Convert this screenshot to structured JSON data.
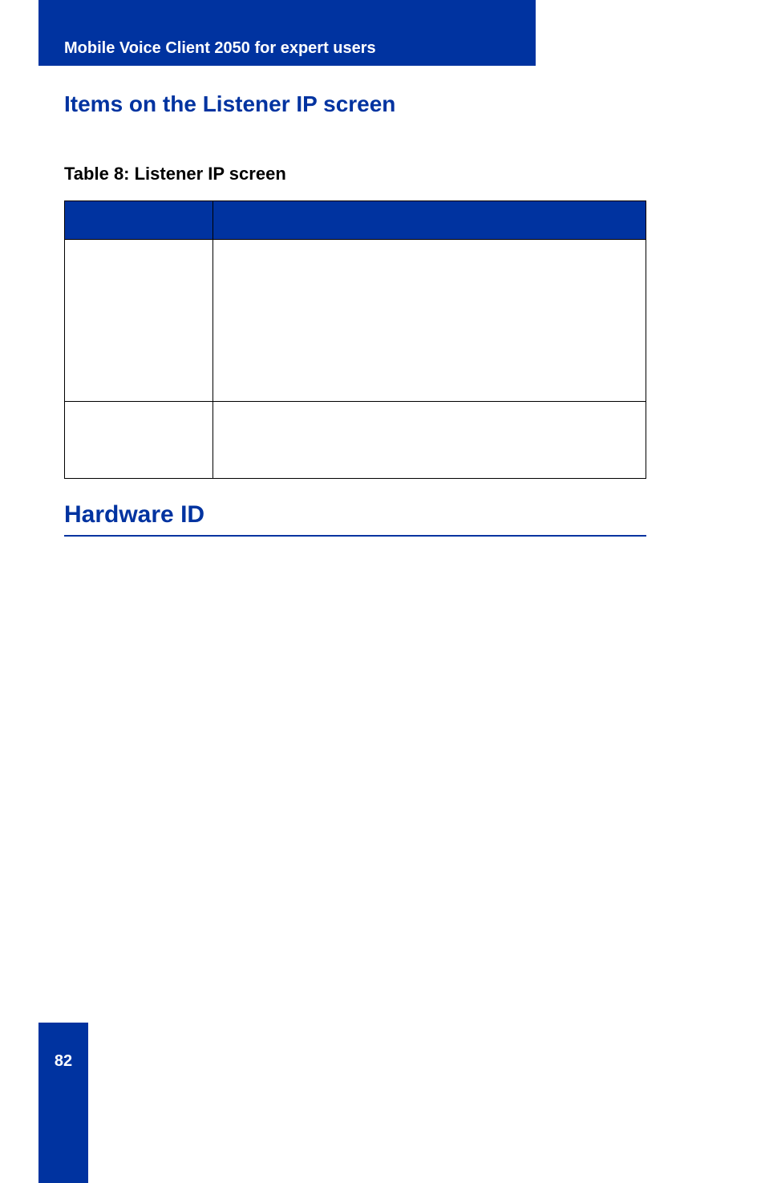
{
  "header": {
    "title": "Mobile Voice Client 2050 for expert users"
  },
  "sections": {
    "listenerHeading": "Items on the Listener IP screen",
    "tableCaption": "Table 8: Listener IP screen",
    "hardwareHeading": "Hardware ID"
  },
  "table": {
    "headers": [
      "",
      ""
    ],
    "rows": [
      [
        "",
        ""
      ],
      [
        "",
        ""
      ]
    ]
  },
  "page": {
    "number": "82"
  }
}
